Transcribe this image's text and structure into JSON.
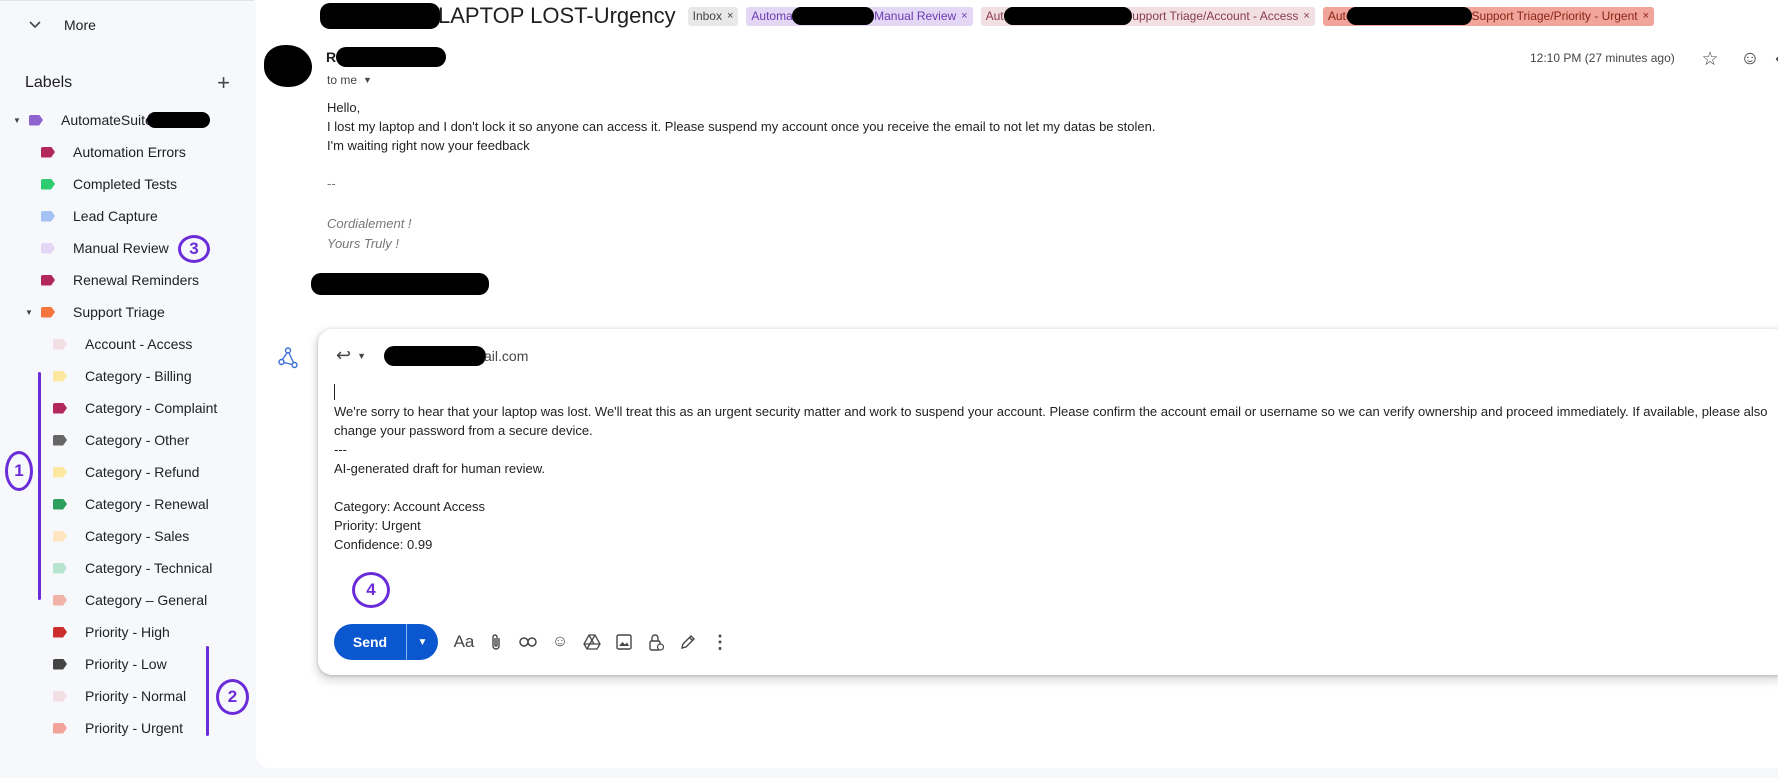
{
  "sidebar": {
    "more_label": "More",
    "labels_heading": "Labels",
    "add_label_glyph": "+",
    "items": [
      {
        "label": "AutomateSuite",
        "color": "#8e63ce"
      },
      {
        "label": "Automation Errors",
        "color": "#b2275e"
      },
      {
        "label": "Completed Tests",
        "color": "#2ecc71"
      },
      {
        "label": "Lead Capture",
        "color": "#a4c2f4"
      },
      {
        "label": "Manual Review",
        "color": "#e4d7f5"
      },
      {
        "label": "Renewal Reminders",
        "color": "#b2275e"
      },
      {
        "label": "Support Triage",
        "color": "#f4753e"
      },
      {
        "label": "Account - Access",
        "color": "#f2dfe4"
      },
      {
        "label": "Category - Billing",
        "color": "#fce8a0"
      },
      {
        "label": "Category - Complaint",
        "color": "#b2275e"
      },
      {
        "label": "Category - Other",
        "color": "#666666"
      },
      {
        "label": "Category - Refund",
        "color": "#fce8a0"
      },
      {
        "label": "Category - Renewal",
        "color": "#2ea05e"
      },
      {
        "label": "Category - Sales",
        "color": "#ffe5c2"
      },
      {
        "label": "Category - Technical",
        "color": "#b9e4d0"
      },
      {
        "label": "Category – General",
        "color": "#f1b2a7"
      },
      {
        "label": "Priority - High",
        "color": "#cc2e2e"
      },
      {
        "label": "Priority - Low",
        "color": "#444444"
      },
      {
        "label": "Priority - Normal",
        "color": "#f2dfe4"
      },
      {
        "label": "Priority - Urgent",
        "color": "#f1a49a"
      }
    ]
  },
  "annotations": {
    "one": "1",
    "two": "2",
    "three": "3",
    "four": "4"
  },
  "email": {
    "subject": "LAPTOP LOST-Urgency",
    "chips": [
      {
        "label": "Inbox",
        "bg": "#e8e8e8",
        "fg": "#444"
      },
      {
        "label": "Automat",
        "bg": "#e4d7f5",
        "fg": "#6a3bb3"
      },
      {
        "label": "Manual Review",
        "bg": "#e4d7f5",
        "fg": "#6a3bb3"
      },
      {
        "label": "Auto",
        "bg": "#f2dfe4",
        "fg": "#8a3b4e"
      },
      {
        "label": "upport Triage/Account - Access",
        "bg": "#f2dfe4",
        "fg": "#8a3b4e"
      },
      {
        "label": "Auto",
        "bg": "#f1a49a",
        "fg": "#8a2418"
      },
      {
        "label": "Support Triage/Priority - Urgent",
        "bg": "#f1a49a",
        "fg": "#8a2418"
      }
    ],
    "chip_close": "×",
    "sender_initial": "R",
    "to": "to me",
    "time": "12:10 PM (27 minutes ago)",
    "body": [
      "Hello,",
      "I lost my laptop and I don't lock it so anyone can access it. Please suspend my account once you receive the email to not let my datas be stolen.",
      "I'm waiting right now your feedback"
    ],
    "dashes": "--",
    "signature": [
      "Cordialement !",
      "Yours Truly !"
    ]
  },
  "reply": {
    "recipient_suffix": "ail.com",
    "draft": {
      "line1": "We're sorry to hear that your laptop was lost. We'll treat this as an urgent security matter and work to suspend your account. Please confirm the account email or username so we can verify ownership and proceed immediately. If available, please also change your password from a secure device.",
      "separator": "---",
      "ai_note": "AI-generated draft for human review.",
      "category": "Category: Account Access",
      "priority": "Priority: Urgent",
      "confidence": "Confidence: 0.99"
    },
    "send_label": "Send",
    "format_label": "Aa"
  }
}
